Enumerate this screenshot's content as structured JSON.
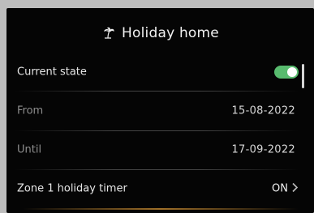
{
  "header": {
    "title": "Holiday home",
    "icon": "palm-tree-icon"
  },
  "rows": [
    {
      "label": "Current state",
      "control": "toggle",
      "toggle_on": true
    },
    {
      "label": "From",
      "value": "15-08-2022"
    },
    {
      "label": "Until",
      "value": "17-09-2022"
    },
    {
      "label": "Zone 1 holiday timer",
      "value": "ON",
      "icon": "chevron-right-icon"
    }
  ],
  "colors": {
    "toggle_on": "#58bb6e",
    "background": "#050505"
  }
}
